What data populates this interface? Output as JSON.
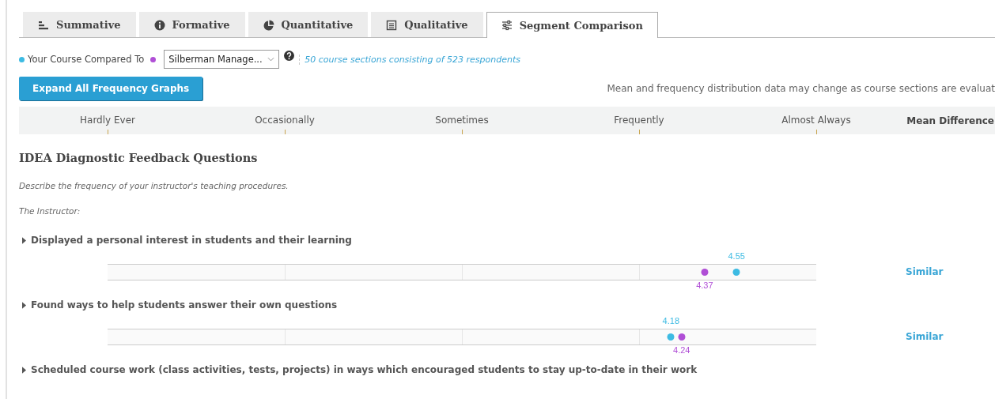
{
  "tabs": [
    {
      "label": "Summative",
      "kind": "bars",
      "selected": false
    },
    {
      "label": "Formative",
      "kind": "info",
      "selected": false
    },
    {
      "label": "Quantitative",
      "kind": "pie",
      "selected": false
    },
    {
      "label": "Qualitative",
      "kind": "list",
      "selected": false
    },
    {
      "label": "Segment Comparison",
      "kind": "sliders",
      "selected": true
    }
  ],
  "legend": [
    {
      "label": "Your Course Compared To",
      "color": "#3dbbe3"
    },
    {
      "color": "#b04fd6"
    }
  ],
  "comparison": {
    "dropdown_value": "Silberman Manage...",
    "respondents_link": "50 course sections consisting of 523 respondents"
  },
  "expand_button": "Expand All Frequency Graphs",
  "notice": "Mean and frequency distribution data may change as course sections are evaluat",
  "scale": {
    "labels": [
      "Hardly Ever",
      "Occasionally",
      "Sometimes",
      "Frequently",
      "Almost Always"
    ],
    "difference_heading": "Mean Difference"
  },
  "section": {
    "title": "IDEA Diagnostic Feedback Questions",
    "description": "Describe the frequency of your instructor's teaching procedures.",
    "subject": "The Instructor:"
  },
  "questions": [
    {
      "text": "Displayed a personal interest in students and their learning",
      "expanded": false,
      "your": {
        "value": "4.55",
        "level": 0.8875
      },
      "comparison": {
        "value": "4.37",
        "level": 0.8425
      },
      "difference": "Similar"
    },
    {
      "text": "Found ways to help students answer their own questions",
      "expanded": false,
      "your": {
        "value": "4.18",
        "level": 0.795
      },
      "comparison": {
        "value": "4.24",
        "level": 0.81
      },
      "difference": "Similar"
    },
    {
      "text": "Scheduled course work (class activities, tests, projects) in ways which encouraged students to stay up-to-date in their work",
      "expanded": false
    }
  ]
}
